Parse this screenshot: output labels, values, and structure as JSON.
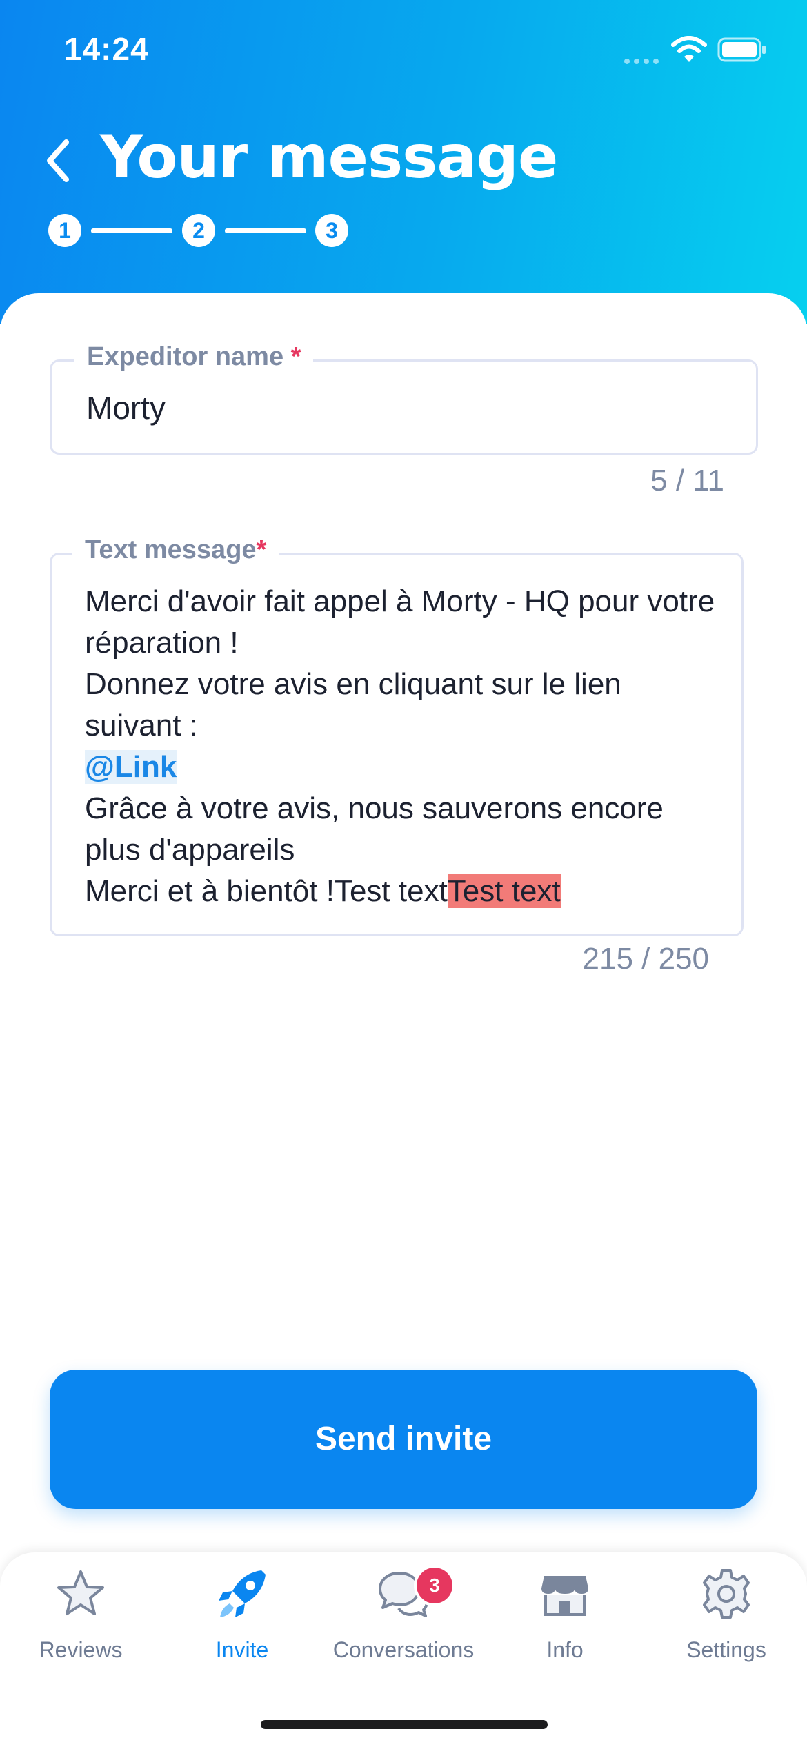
{
  "status": {
    "time": "14:24"
  },
  "header": {
    "title": "Your message",
    "steps": [
      "1",
      "2",
      "3"
    ]
  },
  "expeditor": {
    "label": "Expeditor name",
    "required_mark": "*",
    "value": "Morty",
    "counter": "5 / 11"
  },
  "message": {
    "label": "Text message",
    "required_mark": "*",
    "line1": "Merci d'avoir fait appel à Morty - HQ pour votre réparation !",
    "line2": "Donnez votre avis en cliquant sur le lien suivant :",
    "link": "@Link",
    "line3": "Grâce à votre avis, nous sauverons encore plus d'appareils",
    "line4": "Merci et à bientôt !Test text",
    "highlighted": "Test text",
    "counter": "215 / 250"
  },
  "send_button": {
    "label": "Send invite"
  },
  "tabbar": {
    "items": [
      {
        "label": "Reviews",
        "icon": "star-icon"
      },
      {
        "label": "Invite",
        "icon": "rocket-icon",
        "active": true
      },
      {
        "label": "Conversations",
        "icon": "chat-bubbles-icon",
        "badge": "3"
      },
      {
        "label": "Info",
        "icon": "store-icon"
      },
      {
        "label": "Settings",
        "icon": "gear-icon"
      }
    ]
  },
  "colors": {
    "primary": "#0a86f0",
    "gradient_end": "#06d0ef",
    "required": "#e6375f",
    "highlight": "#f27b78",
    "muted": "#7d8aa3"
  }
}
